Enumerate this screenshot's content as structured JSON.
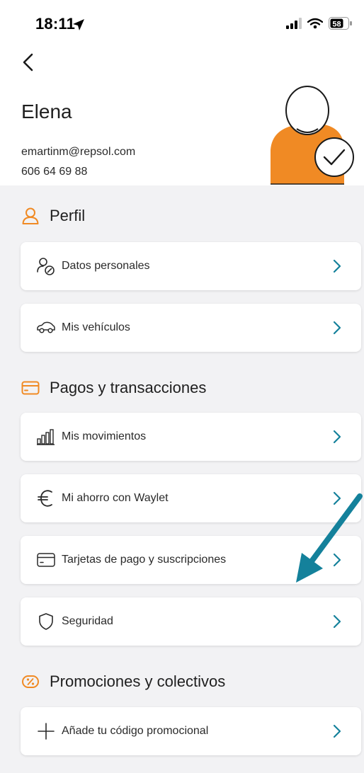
{
  "status_bar": {
    "time": "18:11",
    "battery": "58"
  },
  "profile": {
    "name": "Elena",
    "email": "emartinm@repsol.com",
    "phone": "606 64 69 88"
  },
  "sections": [
    {
      "title": "Perfil",
      "items": [
        {
          "label": "Datos personales"
        },
        {
          "label": "Mis vehículos"
        }
      ]
    },
    {
      "title": "Pagos y transacciones",
      "items": [
        {
          "label": "Mis movimientos"
        },
        {
          "label": "Mi ahorro con Waylet"
        },
        {
          "label": "Tarjetas de pago y suscripciones"
        },
        {
          "label": "Seguridad"
        }
      ]
    },
    {
      "title": "Promociones y colectivos",
      "items": [
        {
          "label": "Añade tu código promocional"
        }
      ]
    }
  ],
  "colors": {
    "accent_orange": "#f08a24",
    "accent_teal": "#14819b"
  },
  "icons": {
    "back": "chevron-left-icon",
    "perfil": "user-icon",
    "datos_personales": "user-edit-icon",
    "vehiculos": "car-icon",
    "pagos": "credit-card-icon",
    "movimientos": "bar-chart-icon",
    "ahorro": "euro-icon",
    "tarjetas": "credit-card-icon",
    "seguridad": "shield-icon",
    "promociones": "percent-icon",
    "codigo": "plus-icon",
    "annotation": "annotation-arrow"
  }
}
